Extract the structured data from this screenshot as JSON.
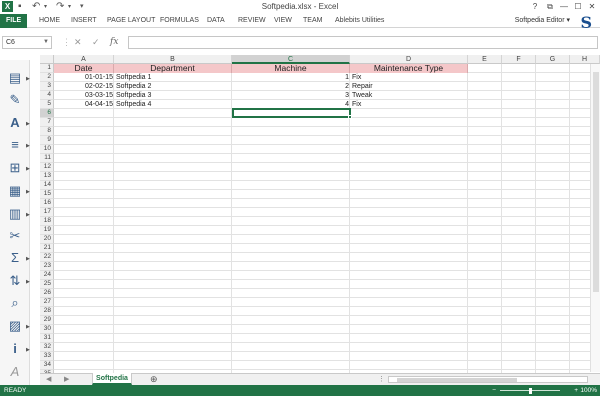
{
  "window": {
    "title": "Softpedia.xlsx - Excel",
    "help": "?",
    "restore": "⧉",
    "minimize": "—",
    "maximize": "☐",
    "close": "✕"
  },
  "quick_access": {
    "undo": "↶",
    "redo": "↷",
    "customize": "▾"
  },
  "ribbon": {
    "tabs": [
      "FILE",
      "HOME",
      "INSERT",
      "PAGE LAYOUT",
      "FORMULAS",
      "DATA",
      "REVIEW",
      "VIEW",
      "TEAM",
      "Ablebits Utilities"
    ],
    "user": "Softpedia Editor",
    "user_caret": "▾",
    "brand_letter": "S"
  },
  "formula_bar": {
    "name_box": "C6",
    "cancel": "✕",
    "enter": "✓",
    "fx": "fx",
    "formula": ""
  },
  "columns": [
    "A",
    "B",
    "C",
    "D",
    "E",
    "F",
    "G",
    "H"
  ],
  "rows": [
    "1",
    "2",
    "3",
    "4",
    "5",
    "6",
    "7",
    "8",
    "9",
    "10",
    "11",
    "12",
    "13",
    "14",
    "15",
    "16",
    "17",
    "18",
    "19",
    "20",
    "21",
    "22",
    "23",
    "24",
    "25",
    "26",
    "27",
    "28",
    "29",
    "30",
    "31",
    "32",
    "33",
    "34",
    "35"
  ],
  "selected_cell": {
    "column": "C",
    "row": "6"
  },
  "table": {
    "headers": [
      "Date",
      "Department",
      "Machine",
      "Maintenance Type"
    ],
    "header_color": "#f4c7c9",
    "rows": [
      [
        "01-01-15",
        "Softpedia 1",
        "1",
        "Fix"
      ],
      [
        "02-02-15",
        "Softpedia 2",
        "2",
        "Repair"
      ],
      [
        "03-03-15",
        "Softpedia 3",
        "3",
        "Tweak"
      ],
      [
        "04-04-15",
        "Softpedia 4",
        "4",
        "Fix"
      ]
    ]
  },
  "sheets": {
    "active": "Softpedia",
    "add": "⊕",
    "prev": "◀",
    "next": "▶",
    "more": "..."
  },
  "status": {
    "ready": "READY",
    "zoom": "100%",
    "zoom_out": "−",
    "zoom_in": "+"
  },
  "left_toolbar": [
    "clipboard-icon",
    "brush-icon",
    "font-icon",
    "align-icon",
    "border-icon",
    "text-tools-icon",
    "column-tools-icon",
    "delete-tools-icon",
    "sum-icon",
    "sort-icon",
    "find-icon",
    "format-icon",
    "info-icon",
    "style-icon"
  ],
  "accent_color": "#217346"
}
